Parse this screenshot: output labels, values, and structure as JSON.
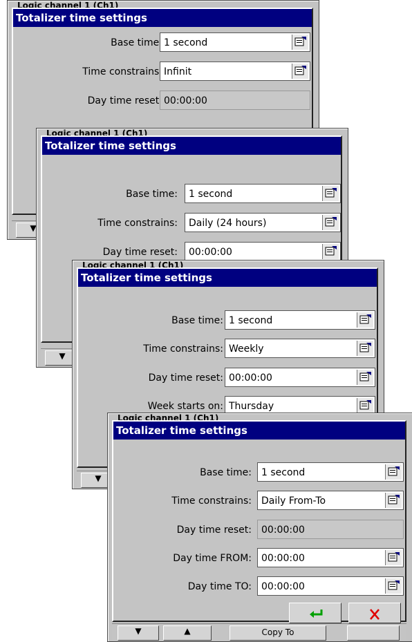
{
  "screens": [
    {
      "background_title": "Logic channel 1 (Ch1)",
      "dialog_title": "Totalizer time settings",
      "rows": [
        {
          "label": "Base time:",
          "value": "1 second",
          "editable": true
        },
        {
          "label": "Time constrains:",
          "value": "Infinit",
          "editable": true
        },
        {
          "label": "Day time reset:",
          "value": "00:00:00",
          "editable": false
        }
      ]
    },
    {
      "background_title": "Logic channel 1 (Ch1)",
      "dialog_title": "Totalizer time settings",
      "rows": [
        {
          "label": "Base time:",
          "value": "1 second",
          "editable": true
        },
        {
          "label": "Time constrains:",
          "value": "Daily (24 hours)",
          "editable": true
        },
        {
          "label": "Day time reset:",
          "value": "00:00:00",
          "editable": true
        }
      ]
    },
    {
      "background_title": "Logic channel 1 (Ch1)",
      "dialog_title": "Totalizer time settings",
      "rows": [
        {
          "label": "Base time:",
          "value": "1 second",
          "editable": true
        },
        {
          "label": "Time constrains:",
          "value": "Weekly",
          "editable": true
        },
        {
          "label": "Day time reset:",
          "value": "00:00:00",
          "editable": true
        },
        {
          "label": "Week starts on:",
          "value": "Thursday",
          "editable": true
        }
      ]
    },
    {
      "background_title": "Logic channel 1 (Ch1)",
      "dialog_title": "Totalizer time settings",
      "rows": [
        {
          "label": "Base time:",
          "value": "1 second",
          "editable": true
        },
        {
          "label": "Time constrains:",
          "value": "Daily From-To",
          "editable": true
        },
        {
          "label": "Day time reset:",
          "value": "00:00:00",
          "editable": false
        },
        {
          "label": "Day time FROM:",
          "value": "00:00:00",
          "editable": true
        },
        {
          "label": "Day time TO:",
          "value": "00:00:00",
          "editable": true
        }
      ],
      "bottom_copy_label": "Copy To"
    }
  ],
  "icons": {
    "field_button": "edit-list-icon",
    "ok": "enter-arrow-icon",
    "cancel": "red-x-icon",
    "nav_down": "arrow-down-icon",
    "nav_up": "arrow-up-icon"
  },
  "colors": {
    "title_bar": "#000080",
    "dialog_bg": "#c4c4c4",
    "ok_arrow": "#00a000",
    "cancel_x": "#e00000"
  }
}
